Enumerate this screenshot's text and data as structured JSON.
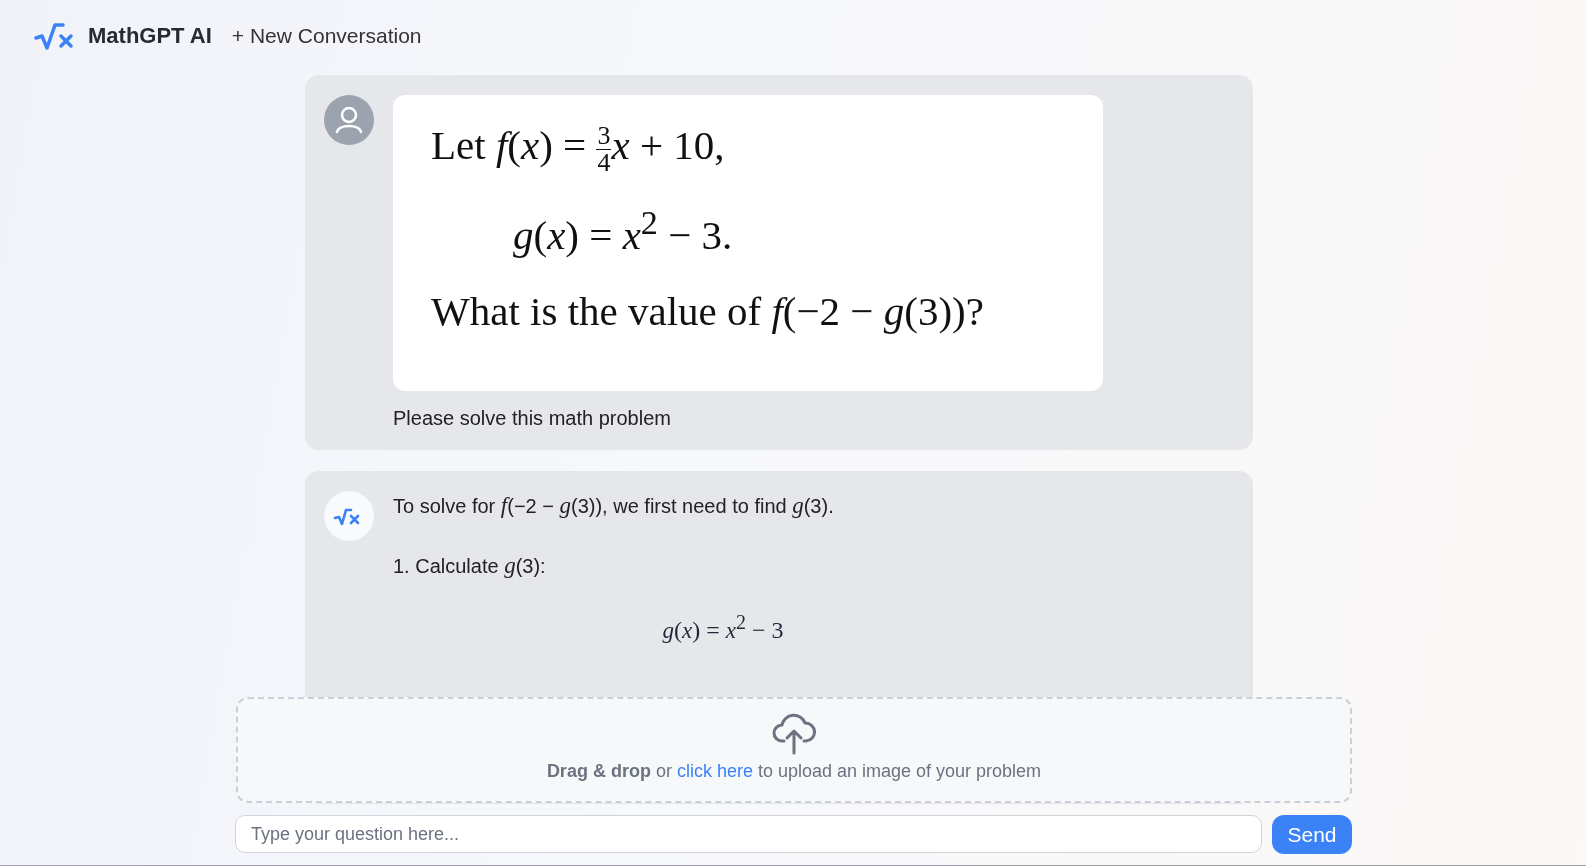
{
  "header": {
    "brand": "MathGPT AI",
    "new_conversation": "+ New Conversation"
  },
  "messages": [
    {
      "kind": "user",
      "math_lines": [
        [
          {
            "kind": "text",
            "text": "Let *f*(*x*) = "
          },
          {
            "kind": "frac",
            "num": "3",
            "den": "4"
          },
          {
            "kind": "text",
            "text": "*x* + 10,"
          }
        ],
        [
          {
            "kind": "text",
            "text": "*g*(*x*) = *x*$^{2}$ − 3."
          }
        ],
        [
          {
            "kind": "text",
            "text": "What is the value of *f*(−2 − *g*(3))?"
          }
        ]
      ],
      "caption": "Please solve this math problem"
    },
    {
      "kind": "assistant",
      "blocks": [
        {
          "kind": "paragraph",
          "text": "To solve for *f*(−2 − *g*(3)), we first need to find *g*(3)."
        },
        {
          "kind": "paragraph",
          "text": "1. Calculate *g*(3):"
        },
        {
          "kind": "equation",
          "text": "*g*(*x*) = *x*$^{2}$ − 3"
        }
      ]
    }
  ],
  "upload": {
    "bold": "Drag & drop",
    "middle": "or",
    "link": "click here",
    "rest": "to upload an image of your problem"
  },
  "composer": {
    "placeholder": "Type your question here...",
    "send": "Send"
  }
}
